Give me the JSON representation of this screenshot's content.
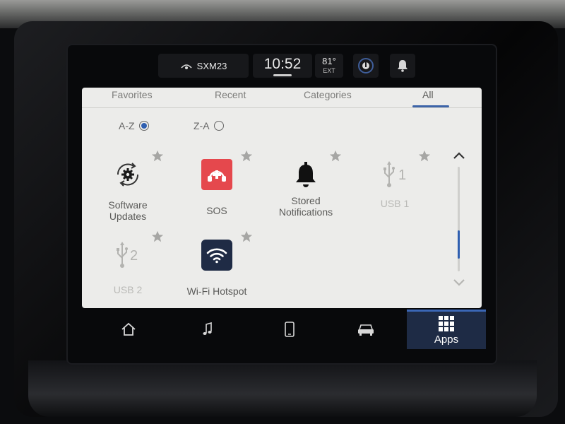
{
  "status": {
    "radio_label": "SXM23",
    "time": "10:52",
    "temperature": "81°",
    "temp_source": "EXT"
  },
  "tabs": [
    {
      "label": "Favorites"
    },
    {
      "label": "Recent"
    },
    {
      "label": "Categories"
    },
    {
      "label": "All",
      "selected": true
    }
  ],
  "sort": {
    "az_label": "A-Z",
    "za_label": "Z-A",
    "selected": "A-Z"
  },
  "apps": [
    {
      "label": "Software\nUpdates",
      "icon": "software-update-icon",
      "enabled": true
    },
    {
      "label": "SOS",
      "icon": "sos-icon",
      "enabled": true
    },
    {
      "label": "Stored\nNotifications",
      "icon": "bell-icon",
      "enabled": true
    },
    {
      "label": "USB 1",
      "icon": "usb-1-icon",
      "enabled": false
    },
    {
      "label": "USB 2",
      "icon": "usb-2-icon",
      "enabled": false
    },
    {
      "label": "Wi-Fi Hotspot",
      "icon": "wifi-icon",
      "enabled": true
    }
  ],
  "nav": {
    "apps_label": "Apps"
  },
  "colors": {
    "accent": "#2f5fb0",
    "sos_red": "#e5484d",
    "wifi_dark": "#1f2b45"
  }
}
